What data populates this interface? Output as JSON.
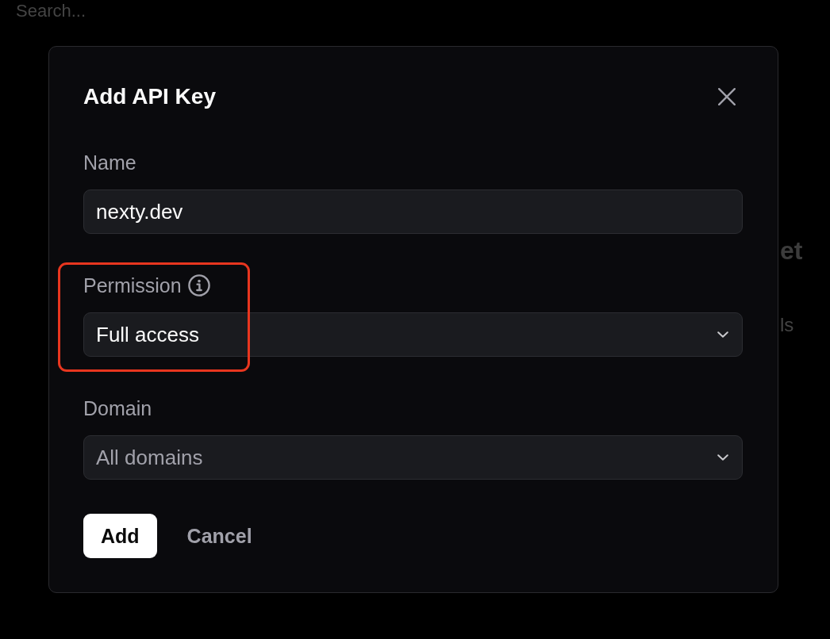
{
  "background": {
    "search": {
      "placeholder": "Search..."
    },
    "heading_fragment": "et",
    "text_fragment": "ls"
  },
  "dialog": {
    "title": "Add API Key",
    "fields": [
      {
        "kind": "text",
        "label": "Name",
        "value": "nexty.dev",
        "info": false,
        "highlighted": false
      },
      {
        "kind": "select",
        "label": "Permission",
        "value": "Full access",
        "info": true,
        "highlighted": true
      },
      {
        "kind": "select",
        "label": "Domain",
        "placeholder": "All domains",
        "info": false,
        "highlighted": false
      }
    ],
    "buttons": [
      {
        "kind": "primary",
        "label": "Add"
      },
      {
        "kind": "ghost",
        "label": "Cancel"
      }
    ]
  }
}
